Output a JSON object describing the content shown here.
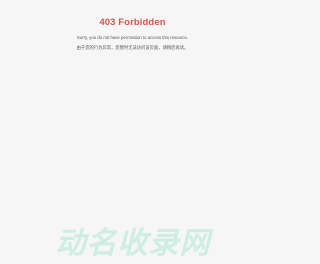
{
  "error": {
    "title": "403 Forbidden",
    "message_en": "Sorry, you do not have permission to access this resource.",
    "message_zh": "由于您的行为异常，您暂时无法访问该页面，请稍后再试。"
  },
  "watermark": {
    "text": "动名收录网",
    "color": "#cdeee1"
  },
  "colors": {
    "title": "#d9534f",
    "text": "#555555",
    "background": "#f6f6f6"
  }
}
